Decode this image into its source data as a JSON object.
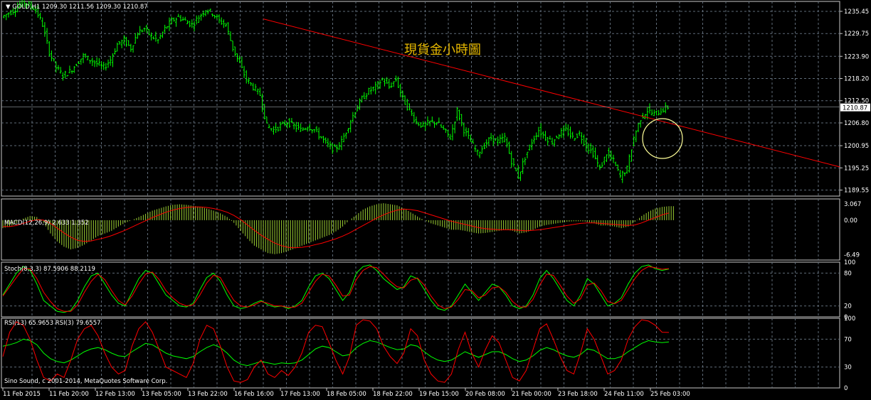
{
  "symbol_header": {
    "menu_icon": "triangle-down-icon",
    "text": "GOLD,H1  1209.30 1211.56 1209.30 1210.87"
  },
  "overlay_title": "現貨金小時圖",
  "copyright": "Sino Sound, c 2001-2014, MetaQuotes Software Corp.",
  "current_price_label": "1210.87",
  "colors": {
    "background": "#000000",
    "candles": "#00ff00",
    "trendline": "#ff0000",
    "circle": "#ffff99",
    "title": "#e6b800",
    "grid": "#5f6b78",
    "macd_hist": "#9acd32",
    "macd_signal": "#ff0000",
    "stoch_main": "#00ff00",
    "stoch_signal": "#ff0000",
    "rsi_13": "#00ff00",
    "rsi_3": "#ff0000"
  },
  "chart_data": [
    {
      "type": "line",
      "subtype": "candlestick",
      "title": "GOLD,H1",
      "ohlc_last": {
        "open": 1209.3,
        "high": 1211.56,
        "low": 1209.3,
        "close": 1210.87
      },
      "x_labels": [
        "11 Feb 2015",
        "11 Feb 20:00",
        "12 Feb 13:00",
        "13 Feb 05:00",
        "13 Feb 22:00",
        "16 Feb 16:00",
        "17 Feb 13:00",
        "18 Feb 05:00",
        "18 Feb 22:00",
        "19 Feb 15:00",
        "20 Feb 08:00",
        "21 Feb 00:00",
        "23 Feb 18:00",
        "24 Feb 11:00",
        "25 Feb 03:00"
      ],
      "y_ticks": [
        "1235.45",
        "1229.75",
        "1223.90",
        "1218.20",
        "1212.50",
        "1206.80",
        "1200.95",
        "1195.25",
        "1189.55"
      ],
      "ylim": [
        1188,
        1238
      ],
      "close_series": [
        1234,
        1235,
        1236,
        1238,
        1237,
        1236,
        1232,
        1225,
        1221,
        1219,
        1220,
        1222,
        1224,
        1223,
        1222,
        1221,
        1223,
        1227,
        1228,
        1226,
        1230,
        1231,
        1229,
        1228,
        1231,
        1233,
        1234,
        1233,
        1232,
        1234,
        1236,
        1235,
        1233,
        1232,
        1226,
        1222,
        1218,
        1216,
        1214,
        1206,
        1205,
        1206,
        1207,
        1206,
        1205,
        1206,
        1205,
        1203,
        1201,
        1200,
        1202,
        1206,
        1210,
        1213,
        1215,
        1216,
        1218,
        1216,
        1218,
        1213,
        1210,
        1207,
        1206,
        1207,
        1207,
        1205,
        1203,
        1210,
        1205,
        1202,
        1199,
        1201,
        1203,
        1202,
        1203,
        1197,
        1193,
        1198,
        1202,
        1205,
        1203,
        1202,
        1204,
        1205,
        1203,
        1204,
        1201,
        1199,
        1195,
        1199,
        1197,
        1193,
        1195,
        1203,
        1208,
        1210,
        1209,
        1210,
        1210.87
      ],
      "trendline": {
        "from": {
          "index": 36,
          "price": 1233.5
        },
        "to": {
          "index": 118,
          "price": 1195.5
        }
      },
      "current_price": 1210.87
    },
    {
      "type": "bar",
      "title": "MACD(12,26,9) 2.633 1.352",
      "y_ticks": [
        "3.067",
        "0.00",
        "-6.49"
      ],
      "ylim": [
        -7.5,
        4.0
      ],
      "histogram": [
        -1.5,
        -1.2,
        -0.6,
        0.3,
        0.8,
        0.6,
        -0.5,
        -2.5,
        -4,
        -5,
        -5.5,
        -5.2,
        -4.6,
        -3.8,
        -3,
        -2.5,
        -2,
        -1.2,
        -0.5,
        0,
        0.6,
        1.2,
        1.8,
        2.2,
        2.6,
        2.9,
        3.0,
        2.9,
        2.7,
        2.5,
        2.2,
        1.8,
        1.3,
        0.6,
        -0.5,
        -2,
        -3.5,
        -4.8,
        -5.5,
        -6.2,
        -6.4,
        -6.2,
        -5.8,
        -5.3,
        -4.8,
        -4.3,
        -3.8,
        -3.3,
        -2.8,
        -2.1,
        -1.2,
        0,
        1.0,
        2.0,
        2.6,
        3.0,
        3.2,
        3.0,
        2.8,
        2.2,
        1.5,
        0.7,
        0,
        -0.6,
        -1,
        -1.4,
        -1.8,
        -1.8,
        -2.0,
        -2.3,
        -2.5,
        -2.4,
        -2.2,
        -2.0,
        -1.8,
        -2.0,
        -2.5,
        -2.3,
        -1.8,
        -1.2,
        -0.9,
        -0.7,
        -0.5,
        -0.3,
        -0.2,
        -0.2,
        -0.3,
        -0.6,
        -1.0,
        -1.0,
        -1.2,
        -1.5,
        -1.2,
        -0.3,
        0.8,
        1.6,
        2.2,
        2.5,
        2.633
      ],
      "signal": [
        -1.2,
        -1.2,
        -1.0,
        -0.6,
        -0.2,
        0.1,
        0,
        -0.6,
        -1.5,
        -2.4,
        -3.2,
        -3.8,
        -4.0,
        -3.9,
        -3.6,
        -3.3,
        -2.9,
        -2.4,
        -1.9,
        -1.3,
        -0.7,
        -0.1,
        0.5,
        1.0,
        1.5,
        1.9,
        2.2,
        2.4,
        2.5,
        2.5,
        2.4,
        2.2,
        1.9,
        1.5,
        0.9,
        0.1,
        -0.9,
        -1.9,
        -2.8,
        -3.6,
        -4.3,
        -4.8,
        -5.1,
        -5.2,
        -5.1,
        -4.9,
        -4.6,
        -4.3,
        -3.9,
        -3.5,
        -3.0,
        -2.4,
        -1.7,
        -1.0,
        -0.3,
        0.4,
        1.0,
        1.5,
        1.9,
        2.1,
        2.0,
        1.8,
        1.4,
        1.0,
        0.6,
        0.2,
        -0.2,
        -0.5,
        -0.8,
        -1.1,
        -1.4,
        -1.6,
        -1.7,
        -1.8,
        -1.8,
        -1.8,
        -1.9,
        -2.0,
        -1.9,
        -1.8,
        -1.6,
        -1.4,
        -1.2,
        -1.0,
        -0.8,
        -0.6,
        -0.5,
        -0.5,
        -0.6,
        -0.7,
        -0.8,
        -0.9,
        -1.0,
        -0.9,
        -0.5,
        0,
        0.5,
        1.0,
        1.352
      ]
    },
    {
      "type": "line",
      "title": "Stoch(8,3,3) 87.5906 88.2119",
      "y_ticks": [
        "100",
        "80",
        "20",
        "0"
      ],
      "ylim": [
        0,
        100
      ],
      "series": [
        {
          "values": [
            40,
            60,
            80,
            92,
            85,
            60,
            30,
            20,
            10,
            8,
            12,
            30,
            55,
            75,
            80,
            60,
            40,
            25,
            20,
            45,
            70,
            85,
            80,
            60,
            40,
            30,
            20,
            18,
            25,
            50,
            72,
            80,
            65,
            40,
            20,
            15,
            18,
            25,
            30,
            22,
            18,
            20,
            15,
            20,
            30,
            55,
            75,
            80,
            70,
            50,
            30,
            45,
            80,
            92,
            95,
            85,
            70,
            60,
            50,
            55,
            75,
            70,
            50,
            30,
            15,
            12,
            20,
            40,
            60,
            45,
            30,
            45,
            60,
            55,
            40,
            20,
            15,
            20,
            40,
            70,
            85,
            70,
            50,
            30,
            20,
            40,
            70,
            60,
            40,
            20,
            25,
            35,
            60,
            80,
            92,
            95,
            88,
            85,
            87.59
          ]
        },
        {
          "values": [
            38,
            55,
            72,
            88,
            88,
            70,
            45,
            28,
            15,
            10,
            10,
            22,
            45,
            65,
            78,
            68,
            48,
            30,
            22,
            38,
            60,
            78,
            82,
            68,
            48,
            35,
            25,
            20,
            22,
            40,
            62,
            76,
            72,
            50,
            30,
            20,
            18,
            22,
            28,
            25,
            20,
            20,
            17,
            18,
            25,
            45,
            65,
            78,
            75,
            58,
            38,
            40,
            68,
            85,
            92,
            90,
            78,
            65,
            55,
            53,
            67,
            71,
            58,
            38,
            22,
            15,
            18,
            32,
            50,
            48,
            35,
            40,
            53,
            55,
            45,
            28,
            18,
            18,
            32,
            58,
            78,
            76,
            58,
            38,
            25,
            33,
            58,
            62,
            48,
            28,
            24,
            30,
            50,
            70,
            85,
            92,
            90,
            87,
            88.21
          ]
        }
      ]
    },
    {
      "type": "line",
      "title": "RSI(13) 65.9653  RSI(3) 79.6557",
      "y_ticks": [
        "100",
        "70",
        "30",
        "0"
      ],
      "ylim": [
        0,
        100
      ],
      "series": [
        {
          "values": [
            60,
            62,
            65,
            70,
            68,
            62,
            50,
            42,
            38,
            36,
            40,
            46,
            52,
            56,
            58,
            55,
            50,
            46,
            45,
            52,
            58,
            64,
            62,
            56,
            50,
            46,
            44,
            42,
            45,
            52,
            58,
            62,
            58,
            50,
            40,
            34,
            32,
            35,
            38,
            36,
            34,
            36,
            35,
            36,
            40,
            48,
            56,
            60,
            58,
            52,
            46,
            48,
            58,
            64,
            68,
            66,
            62,
            58,
            55,
            56,
            62,
            60,
            52,
            45,
            40,
            38,
            40,
            46,
            52,
            48,
            44,
            48,
            52,
            52,
            48,
            42,
            38,
            40,
            46,
            54,
            58,
            55,
            50,
            46,
            44,
            48,
            56,
            54,
            48,
            42,
            42,
            45,
            52,
            58,
            64,
            68,
            66,
            65,
            65.97
          ]
        },
        {
          "values": [
            45,
            80,
            95,
            90,
            70,
            40,
            15,
            10,
            20,
            15,
            40,
            70,
            85,
            90,
            75,
            50,
            30,
            20,
            25,
            60,
            85,
            95,
            80,
            55,
            30,
            25,
            20,
            15,
            35,
            70,
            90,
            85,
            60,
            30,
            10,
            8,
            12,
            30,
            40,
            20,
            15,
            25,
            18,
            30,
            50,
            80,
            90,
            88,
            65,
            40,
            20,
            45,
            90,
            98,
            96,
            85,
            60,
            45,
            35,
            50,
            85,
            75,
            40,
            20,
            10,
            8,
            20,
            55,
            80,
            50,
            30,
            55,
            75,
            65,
            40,
            15,
            10,
            25,
            55,
            85,
            92,
            70,
            45,
            25,
            20,
            50,
            85,
            70,
            45,
            20,
            25,
            40,
            70,
            88,
            98,
            96,
            90,
            80,
            79.66
          ]
        }
      ]
    }
  ]
}
